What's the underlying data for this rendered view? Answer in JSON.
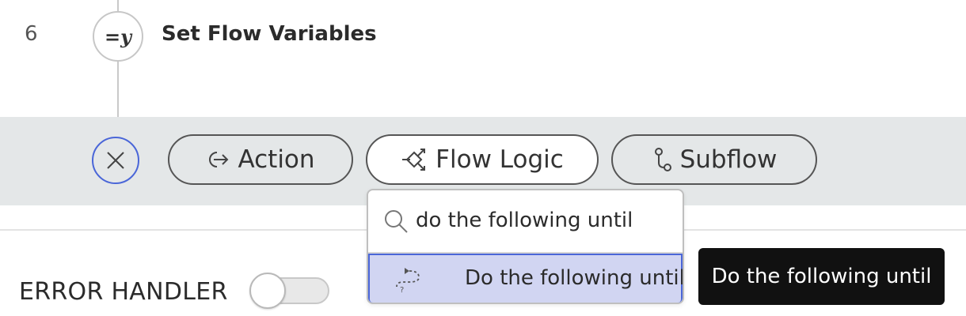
{
  "step": {
    "number": "6",
    "icon_text": "=y",
    "icon": "set-variables-icon",
    "title": "Set Flow Variables"
  },
  "add_bar": {
    "close_icon": "close-icon",
    "buttons": [
      {
        "label": "Action",
        "icon": "action-arrow-icon",
        "active": false
      },
      {
        "label": "Flow Logic",
        "icon": "flow-logic-icon",
        "active": true
      },
      {
        "label": "Subflow",
        "icon": "subflow-icon",
        "active": false
      }
    ]
  },
  "dropdown": {
    "search_icon": "search-icon",
    "search_value": "do the following until",
    "results": [
      {
        "label": "Do the following until",
        "icon": "loop-icon",
        "highlighted": true
      }
    ]
  },
  "tooltip": {
    "text": "Do the following until"
  },
  "error_handler": {
    "label": "ERROR HANDLER",
    "enabled": false
  },
  "colors": {
    "accent": "#4a66d8",
    "highlight_bg": "#d1d5f2",
    "bar_bg": "#e4e7e8",
    "tooltip_bg": "#111111"
  }
}
